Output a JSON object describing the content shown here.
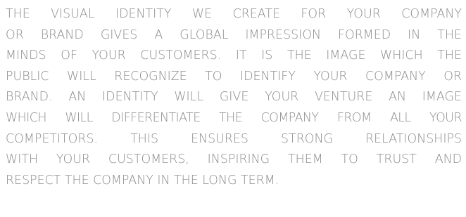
{
  "paragraph": {
    "lines": [
      "THE VISUAL IDENTITY WE CREATE FOR YOUR COMPANY",
      "OR BRAND GIVES A GLOBAL IMPRESSION FORMED IN THE",
      "MINDS OF YOUR CUSTOMERS. IT IS THE IMAGE WHICH THE",
      "PUBLIC WILL RECOGNIZE TO IDENTIFY YOUR COMPANY OR",
      "BRAND. AN IDENTITY WILL GIVE YOUR VENTURE AN IMAGE",
      "WHICH WILL DIFFERENTIATE THE COMPANY FROM ALL YOUR",
      "COMPETITORS. THIS ENSURES STRONG RELATIONSHIPS",
      "WITH YOUR CUSTOMERS, INSPIRING THEM TO TRUST AND",
      "RESPECT THE COMPANY IN THE LONG TERM."
    ]
  }
}
